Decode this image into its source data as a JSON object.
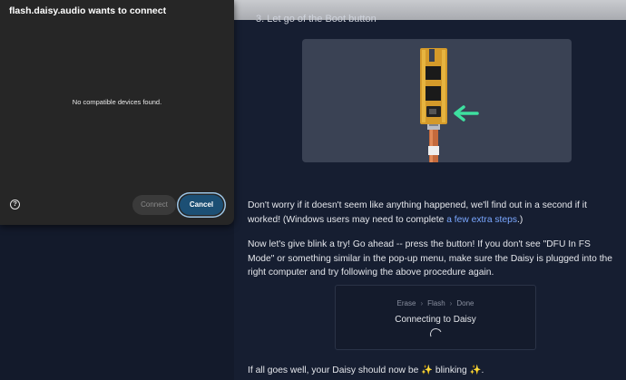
{
  "dialog": {
    "title": "flash.daisy.audio wants to connect",
    "empty_message": "No compatible devices found.",
    "help_icon": "?",
    "connect_label": "Connect",
    "cancel_label": "Cancel"
  },
  "page": {
    "step3_text": "3. Let go of the Boot button",
    "image_arrow_color": "#3ee0a0",
    "para1_prefix": "Don't worry if it doesn't seem like anything happened, we'll find out in a second if it worked! (Windows users may need to complete ",
    "para1_link": "a few extra steps",
    "para1_suffix": ".)",
    "para2": "Now let's give blink a try! Go ahead -- press the button! If you don't see \"DFU In FS Mode\" or something similar in the pop-up menu, make sure the Daisy is plugged into the right computer and try following the above procedure again.",
    "para3": "If all goes well, your Daisy should now be ✨ blinking ✨."
  },
  "flasher": {
    "steps": [
      "Erase",
      "Flash",
      "Done"
    ],
    "status": "Connecting to Daisy"
  }
}
